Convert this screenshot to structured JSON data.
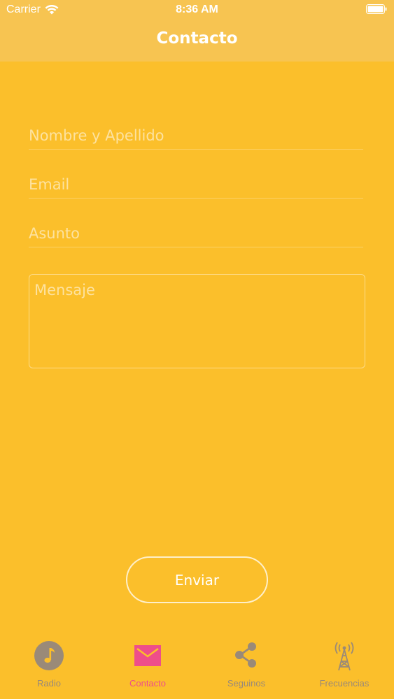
{
  "status_bar": {
    "carrier": "Carrier",
    "time": "8:36 AM",
    "wifi_icon": "wifi-icon",
    "battery_icon": "battery-icon"
  },
  "nav": {
    "title": "Contacto"
  },
  "form": {
    "name_placeholder": "Nombre y Apellido",
    "email_placeholder": "Email",
    "subject_placeholder": "Asunto",
    "message_placeholder": "Mensaje",
    "send_label": "Enviar"
  },
  "tabs": [
    {
      "label": "Radio",
      "icon": "music-note-icon",
      "active": false
    },
    {
      "label": "Contacto",
      "icon": "envelope-icon",
      "active": true
    },
    {
      "label": "Seguinos",
      "icon": "share-icon",
      "active": false
    },
    {
      "label": "Frecuencias",
      "icon": "radio-tower-icon",
      "active": false
    }
  ],
  "colors": {
    "background": "#fbbf2b",
    "header": "#f7c451",
    "active_tab": "#ee4e8a",
    "inactive_tab": "#9a8a78"
  }
}
